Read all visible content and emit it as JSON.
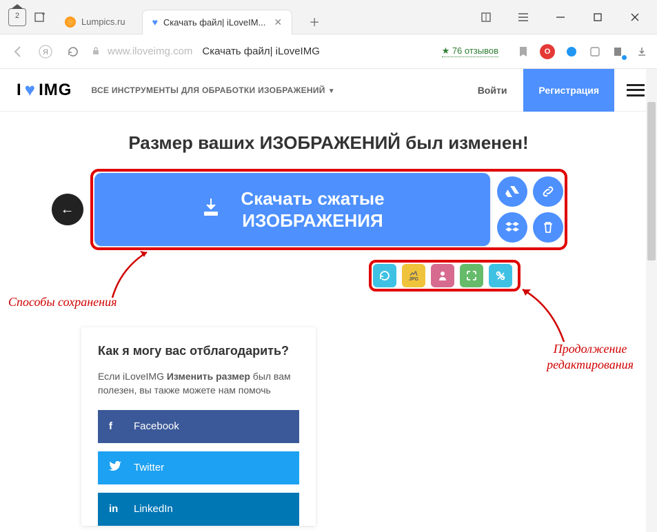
{
  "browser": {
    "home_badge": "2",
    "tabs": [
      {
        "label": "Lumpics.ru",
        "active": false
      },
      {
        "label": "Скачать файл| iLoveIM...",
        "active": true
      }
    ],
    "url_host": "www.iloveimg.com",
    "url_title": "Скачать файл| iLoveIMG",
    "reviews": "★ 76 отзывов"
  },
  "site": {
    "logo_i": "I",
    "logo_img": "IMG",
    "tools_label": "ВСЕ ИНСТРУМЕНТЫ ДЛЯ ОБРАБОТКИ ИЗОБРАЖЕНИЙ",
    "login": "Войти",
    "register": "Регистрация"
  },
  "page": {
    "heading": "Размер ваших ИЗОБРАЖЕНИЙ был изменен!",
    "download_line1": "Скачать сжатые",
    "download_line2": "ИЗОБРАЖЕНИЯ",
    "thank_title": "Как я могу вас отблагодарить?",
    "thank_text_1": "Если iLoveIMG ",
    "thank_text_bold": "Изменить размер",
    "thank_text_2": " был вам полезен, вы также можете нам помочь",
    "share": {
      "fb": "Facebook",
      "tw": "Twitter",
      "li": "LinkedIn"
    },
    "jpg_label": "JPG"
  },
  "annotations": {
    "left": "Способы сохранения",
    "right_l1": "Продолжение",
    "right_l2": "редактирования"
  }
}
